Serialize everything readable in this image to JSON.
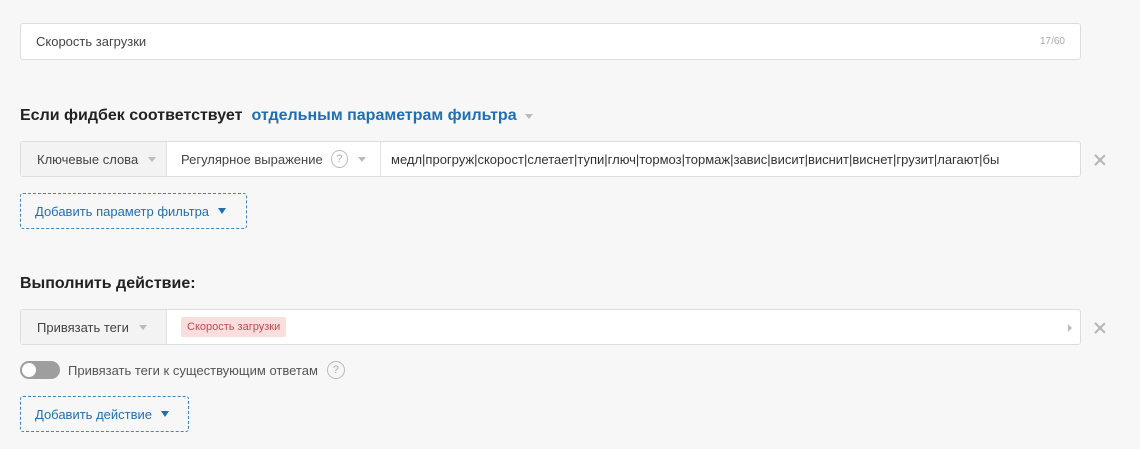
{
  "rule_name": {
    "value": "Скорость загрузки",
    "counter": "17/60"
  },
  "filter_section": {
    "title": "Если фидбек соответствует",
    "mode_link": "отдельным параметрам фильтра"
  },
  "filter_row": {
    "field": "Ключевые слова",
    "operator": "Регулярное выражение",
    "value": "медл|прогруж|скорост|слетает|тупи|глюч|тормоз|тормаж|завис|висит|виснит|виснет|грузит|лагают|бы"
  },
  "add_filter_button": "Добавить параметр фильтра",
  "action_section": {
    "title": "Выполнить действие:"
  },
  "action_row": {
    "action": "Привязать теги",
    "tag": "Скорость загрузки"
  },
  "toggle": {
    "label": "Привязать теги к существующим ответам",
    "on": false
  },
  "add_action_button": "Добавить действие",
  "icons": {
    "help": "?",
    "close": "close-icon"
  },
  "colors": {
    "link": "#1f6fb4",
    "tag_bg": "#f9dede",
    "tag_text": "#c9474d",
    "toggle_off": "#9e9e9e"
  }
}
